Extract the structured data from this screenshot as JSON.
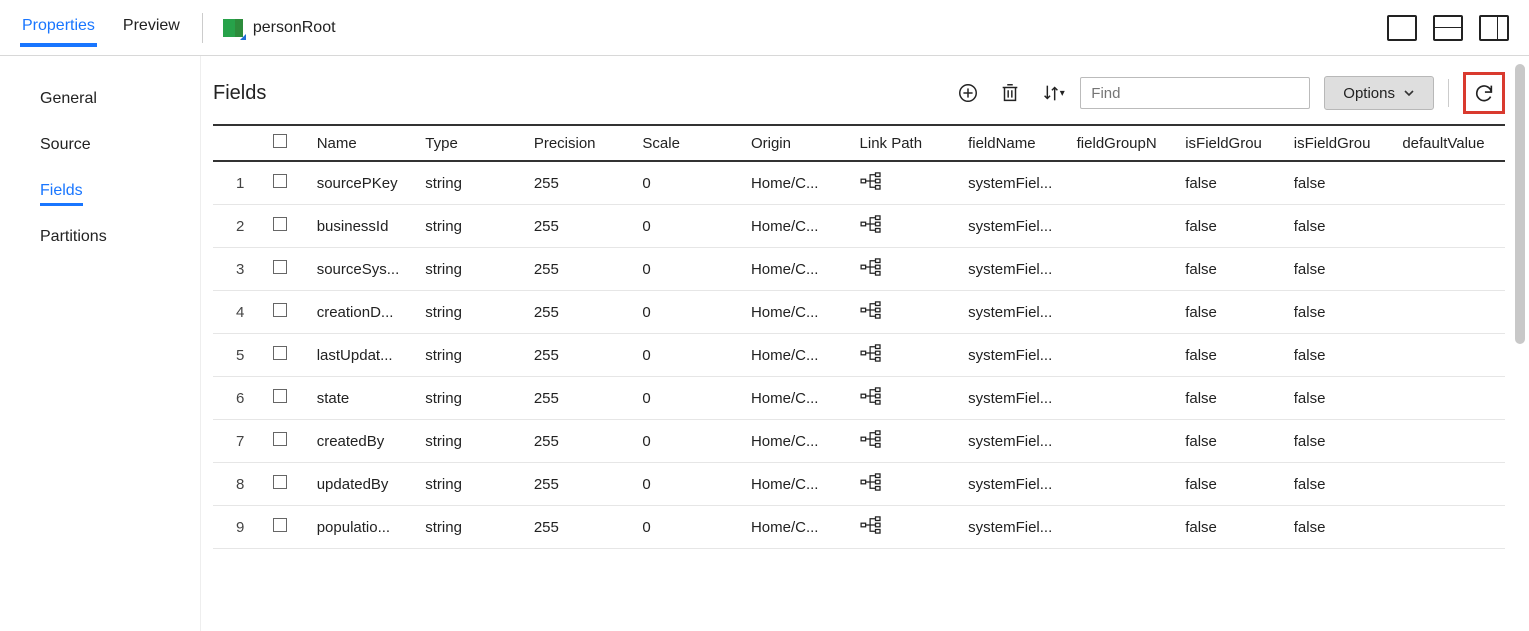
{
  "topTabs": {
    "properties": "Properties",
    "preview": "Preview"
  },
  "entity": {
    "name": "personRoot"
  },
  "sidebar": {
    "items": [
      "General",
      "Source",
      "Fields",
      "Partitions"
    ],
    "activeIndex": 2
  },
  "section": {
    "title": "Fields"
  },
  "toolbar": {
    "findPlaceholder": "Find",
    "optionsLabel": "Options"
  },
  "columns": [
    "",
    "",
    "Name",
    "Type",
    "Precision",
    "Scale",
    "Origin",
    "Link Path",
    "fieldName",
    "fieldGroupName",
    "isFieldGroup",
    "isFieldGroup",
    "defaultValue"
  ],
  "rows": [
    {
      "idx": "1",
      "name": "sourcePKey",
      "type": "string",
      "precision": "255",
      "scale": "0",
      "origin": "Home/C...",
      "fieldName": "systemFiel...",
      "fieldGroup": "",
      "isFG1": "false",
      "isFG2": "false",
      "defaultValue": ""
    },
    {
      "idx": "2",
      "name": "businessId",
      "type": "string",
      "precision": "255",
      "scale": "0",
      "origin": "Home/C...",
      "fieldName": "systemFiel...",
      "fieldGroup": "",
      "isFG1": "false",
      "isFG2": "false",
      "defaultValue": ""
    },
    {
      "idx": "3",
      "name": "sourceSys...",
      "type": "string",
      "precision": "255",
      "scale": "0",
      "origin": "Home/C...",
      "fieldName": "systemFiel...",
      "fieldGroup": "",
      "isFG1": "false",
      "isFG2": "false",
      "defaultValue": ""
    },
    {
      "idx": "4",
      "name": "creationD...",
      "type": "string",
      "precision": "255",
      "scale": "0",
      "origin": "Home/C...",
      "fieldName": "systemFiel...",
      "fieldGroup": "",
      "isFG1": "false",
      "isFG2": "false",
      "defaultValue": ""
    },
    {
      "idx": "5",
      "name": "lastUpdat...",
      "type": "string",
      "precision": "255",
      "scale": "0",
      "origin": "Home/C...",
      "fieldName": "systemFiel...",
      "fieldGroup": "",
      "isFG1": "false",
      "isFG2": "false",
      "defaultValue": ""
    },
    {
      "idx": "6",
      "name": "state",
      "type": "string",
      "precision": "255",
      "scale": "0",
      "origin": "Home/C...",
      "fieldName": "systemFiel...",
      "fieldGroup": "",
      "isFG1": "false",
      "isFG2": "false",
      "defaultValue": ""
    },
    {
      "idx": "7",
      "name": "createdBy",
      "type": "string",
      "precision": "255",
      "scale": "0",
      "origin": "Home/C...",
      "fieldName": "systemFiel...",
      "fieldGroup": "",
      "isFG1": "false",
      "isFG2": "false",
      "defaultValue": ""
    },
    {
      "idx": "8",
      "name": "updatedBy",
      "type": "string",
      "precision": "255",
      "scale": "0",
      "origin": "Home/C...",
      "fieldName": "systemFiel...",
      "fieldGroup": "",
      "isFG1": "false",
      "isFG2": "false",
      "defaultValue": ""
    },
    {
      "idx": "9",
      "name": "populatio...",
      "type": "string",
      "precision": "255",
      "scale": "0",
      "origin": "Home/C...",
      "fieldName": "systemFiel...",
      "fieldGroup": "",
      "isFG1": "false",
      "isFG2": "false",
      "defaultValue": ""
    }
  ]
}
